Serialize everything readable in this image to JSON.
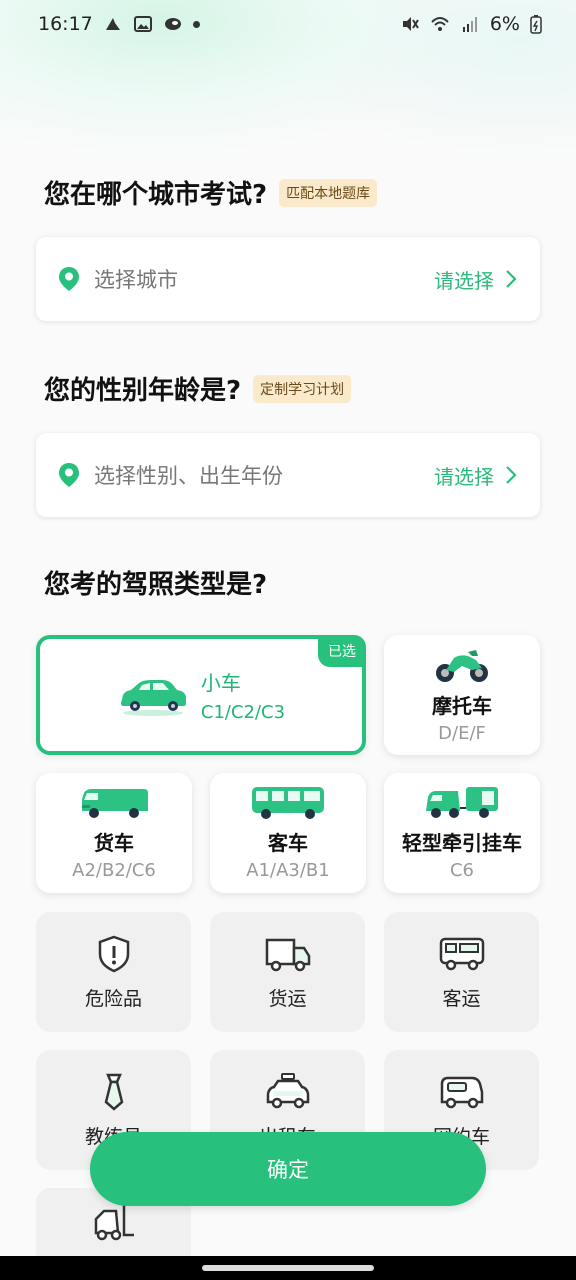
{
  "status_bar": {
    "time": "16:17",
    "battery": "6%"
  },
  "city_section": {
    "title": "您在哪个城市考试?",
    "tag": "匹配本地题库",
    "select_label": "选择城市",
    "action": "请选择"
  },
  "gender_section": {
    "title": "您的性别年龄是?",
    "tag": "定制学习计划",
    "select_label": "选择性别、出生年份",
    "action": "请选择"
  },
  "license_section": {
    "title": "您考的驾照类型是?",
    "selected_badge": "已选",
    "vehicles": [
      {
        "name": "小车",
        "sub": "C1/C2/C3",
        "icon": "car-icon",
        "selected": true
      },
      {
        "name": "摩托车",
        "sub": "D/E/F",
        "icon": "motorcycle-icon"
      },
      {
        "name": "货车",
        "sub": "A2/B2/C6",
        "icon": "truck-icon"
      },
      {
        "name": "客车",
        "sub": "A1/A3/B1",
        "icon": "bus-icon"
      },
      {
        "name": "轻型牵引挂车",
        "sub": "C6",
        "icon": "trailer-icon"
      }
    ],
    "others": [
      {
        "name": "危险品",
        "icon": "hazard-shield-icon"
      },
      {
        "name": "货运",
        "icon": "freight-van-icon"
      },
      {
        "name": "客运",
        "icon": "passenger-bus-icon"
      },
      {
        "name": "教练员",
        "icon": "tie-icon"
      },
      {
        "name": "出租车",
        "icon": "taxi-icon"
      },
      {
        "name": "网约车",
        "icon": "ride-hailing-car-icon"
      },
      {
        "name": "",
        "icon": "forklift-icon"
      }
    ]
  },
  "confirm_button": "确定",
  "colors": {
    "accent": "#27c07d",
    "tag_bg": "#fbe9cc"
  }
}
